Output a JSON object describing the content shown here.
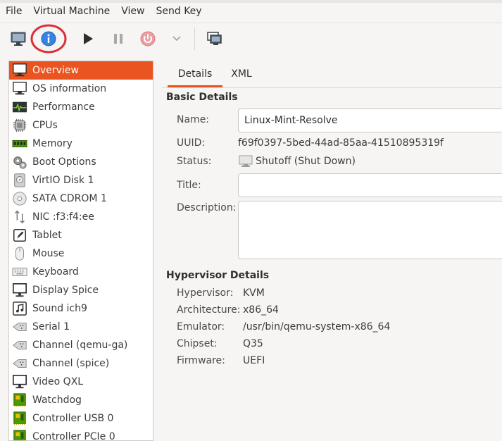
{
  "menu": [
    "File",
    "Virtual Machine",
    "View",
    "Send Key"
  ],
  "toolbar": {
    "buttons": [
      "console-icon",
      "info-icon",
      "play-icon",
      "pause-icon",
      "power-icon",
      "dropdown-chevron-icon",
      "snapshot-icon"
    ],
    "highlight_color": "#d9303a",
    "info_color": "#3584e4"
  },
  "sidebar": {
    "items": [
      {
        "label": "Overview",
        "icon": "monitor-icon",
        "selected": true
      },
      {
        "label": "OS information",
        "icon": "monitor-icon"
      },
      {
        "label": "Performance",
        "icon": "performance-icon"
      },
      {
        "label": "CPUs",
        "icon": "cpu-icon"
      },
      {
        "label": "Memory",
        "icon": "memory-icon"
      },
      {
        "label": "Boot Options",
        "icon": "gears-icon"
      },
      {
        "label": "VirtIO Disk 1",
        "icon": "disk-icon"
      },
      {
        "label": "SATA CDROM 1",
        "icon": "cdrom-icon"
      },
      {
        "label": "NIC :f3:f4:ee",
        "icon": "network-icon"
      },
      {
        "label": "Tablet",
        "icon": "tablet-icon"
      },
      {
        "label": "Mouse",
        "icon": "mouse-icon"
      },
      {
        "label": "Keyboard",
        "icon": "keyboard-icon"
      },
      {
        "label": "Display Spice",
        "icon": "display-icon"
      },
      {
        "label": "Sound ich9",
        "icon": "sound-icon"
      },
      {
        "label": "Serial 1",
        "icon": "serial-icon"
      },
      {
        "label": "Channel (qemu-ga)",
        "icon": "channel-icon"
      },
      {
        "label": "Channel (spice)",
        "icon": "channel-icon"
      },
      {
        "label": "Video QXL",
        "icon": "video-icon"
      },
      {
        "label": "Watchdog",
        "icon": "pci-card-icon"
      },
      {
        "label": "Controller USB 0",
        "icon": "pci-card-icon"
      },
      {
        "label": "Controller PCIe 0",
        "icon": "pci-card-icon"
      }
    ],
    "selected_color": "#e95420"
  },
  "tabs": [
    {
      "label": "Details",
      "active": true
    },
    {
      "label": "XML",
      "active": false
    }
  ],
  "basic": {
    "title": "Basic Details",
    "name_label": "Name:",
    "name_value": "Linux-Mint-Resolve",
    "uuid_label": "UUID:",
    "uuid_value": "f69f0397-5bed-44ad-85aa-41510895319f",
    "status_label": "Status:",
    "status_value": "Shutoff (Shut Down)",
    "title_label": "Title:",
    "title_value": "",
    "description_label": "Description:",
    "description_value": ""
  },
  "hypervisor": {
    "title": "Hypervisor Details",
    "rows": [
      {
        "label": "Hypervisor:",
        "value": "KVM"
      },
      {
        "label": "Architecture:",
        "value": "x86_64"
      },
      {
        "label": "Emulator:",
        "value": "/usr/bin/qemu-system-x86_64"
      },
      {
        "label": "Chipset:",
        "value": "Q35"
      },
      {
        "label": "Firmware:",
        "value": "UEFI"
      }
    ]
  }
}
